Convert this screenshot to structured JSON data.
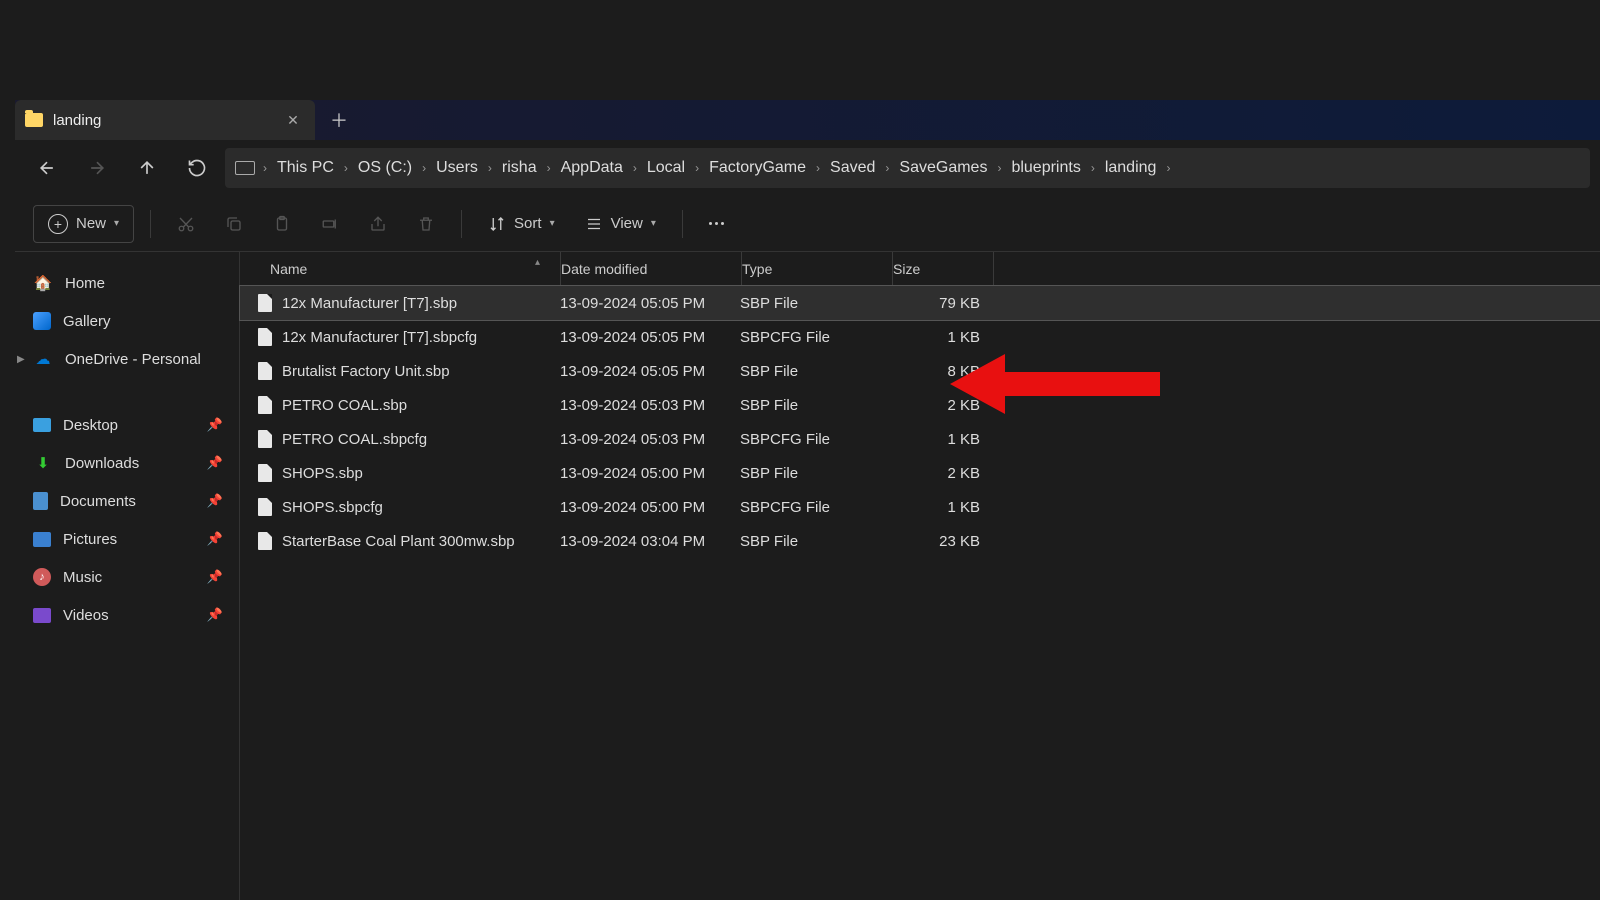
{
  "tab": {
    "label": "landing"
  },
  "breadcrumb": [
    "This PC",
    "OS (C:)",
    "Users",
    "risha",
    "AppData",
    "Local",
    "FactoryGame",
    "Saved",
    "SaveGames",
    "blueprints",
    "landing"
  ],
  "toolbar": {
    "new": "New",
    "sort": "Sort",
    "view": "View"
  },
  "sidebar": {
    "home": "Home",
    "gallery": "Gallery",
    "onedrive": "OneDrive - Personal",
    "desktop": "Desktop",
    "downloads": "Downloads",
    "documents": "Documents",
    "pictures": "Pictures",
    "music": "Music",
    "videos": "Videos"
  },
  "columns": {
    "name": "Name",
    "date": "Date modified",
    "type": "Type",
    "size": "Size"
  },
  "files": [
    {
      "name": "12x Manufacturer [T7].sbp",
      "date": "13-09-2024 05:05 PM",
      "type": "SBP File",
      "size": "79 KB"
    },
    {
      "name": "12x Manufacturer [T7].sbpcfg",
      "date": "13-09-2024 05:05 PM",
      "type": "SBPCFG File",
      "size": "1 KB"
    },
    {
      "name": "Brutalist Factory Unit.sbp",
      "date": "13-09-2024 05:05 PM",
      "type": "SBP File",
      "size": "8 KB"
    },
    {
      "name": "PETRO COAL.sbp",
      "date": "13-09-2024 05:03 PM",
      "type": "SBP File",
      "size": "2 KB"
    },
    {
      "name": "PETRO COAL.sbpcfg",
      "date": "13-09-2024 05:03 PM",
      "type": "SBPCFG File",
      "size": "1 KB"
    },
    {
      "name": "SHOPS.sbp",
      "date": "13-09-2024 05:00 PM",
      "type": "SBP File",
      "size": "2 KB"
    },
    {
      "name": "SHOPS.sbpcfg",
      "date": "13-09-2024 05:00 PM",
      "type": "SBPCFG File",
      "size": "1 KB"
    },
    {
      "name": "StarterBase Coal Plant 300mw.sbp",
      "date": "13-09-2024 03:04 PM",
      "type": "SBP File",
      "size": "23 KB"
    }
  ],
  "annotation": {
    "arrow_target_row": 2
  }
}
